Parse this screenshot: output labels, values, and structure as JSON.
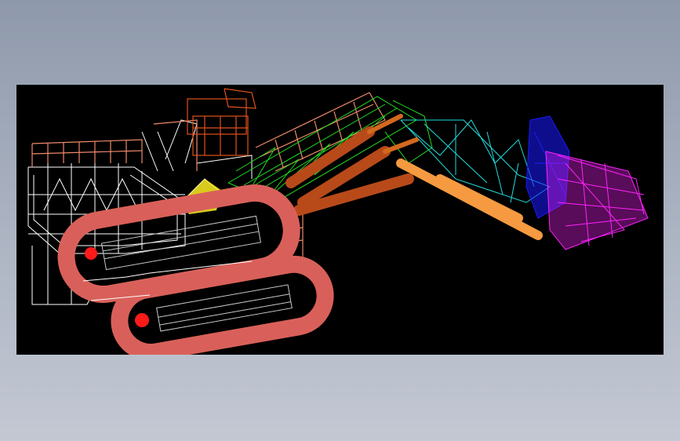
{
  "viewport": {
    "background": "#000000",
    "page_background_top": "#8e99ab",
    "page_background_bottom": "#c3c8d3"
  },
  "model": {
    "colors": {
      "body_frame": "#ffffff",
      "railings": "#f08a6a",
      "cab": "#e0521a",
      "tracks": "#d9605a",
      "track_frame": "#c8c8c8",
      "boom": "#22dd22",
      "boom_cylinders": "#b84a1a",
      "stick_frame": "#22dddd",
      "stick_cylinder": "#f59a40",
      "bucket_back": "#1a1aff",
      "bucket": "#ff22ff",
      "accent_yellow": "#ffee22",
      "accent_red": "#ff1a1a"
    }
  }
}
